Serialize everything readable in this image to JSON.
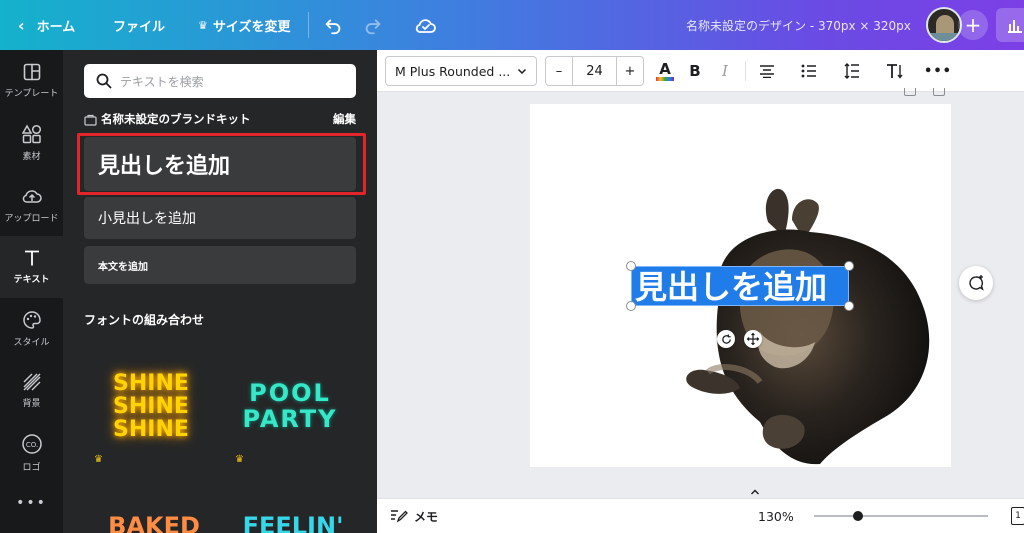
{
  "topbar": {
    "home": "ホーム",
    "file": "ファイル",
    "resize": "サイズを変更",
    "title": "名称未設定のデザイン - 370px × 320px"
  },
  "rail": {
    "items": [
      {
        "label": "テンプレート",
        "icon": "layout-icon"
      },
      {
        "label": "素材",
        "icon": "shapes-icon"
      },
      {
        "label": "アップロード",
        "icon": "upload-icon"
      },
      {
        "label": "テキスト",
        "icon": "text-icon"
      },
      {
        "label": "スタイル",
        "icon": "palette-icon"
      },
      {
        "label": "背景",
        "icon": "hatch-icon"
      },
      {
        "label": "ロゴ",
        "icon": "logo-icon"
      }
    ]
  },
  "panel": {
    "search_placeholder": "テキストを検索",
    "brand_kit": "名称未設定のブランドキット",
    "edit": "編集",
    "add_heading": "見出しを追加",
    "add_subheading": "小見出しを追加",
    "add_body": "本文を追加",
    "font_combos": "フォントの組み合わせ",
    "combos": [
      {
        "text": [
          "SHINE",
          "SHINE",
          "SHINE"
        ],
        "color": "#ffd400"
      },
      {
        "text": [
          "POOL",
          "PARTY"
        ],
        "color": "#37e8c8"
      },
      {
        "text": [
          "BAKED"
        ],
        "color": "#ff8c42"
      },
      {
        "text": [
          "FEELIN'"
        ],
        "color": "#36d7e8"
      }
    ]
  },
  "toolbar": {
    "font": "M Plus Rounded ...",
    "font_size": "24",
    "bold": "B",
    "italic": "I"
  },
  "canvas": {
    "text": "見出しを追加",
    "selection_color": "#1f7ce8"
  },
  "bottombar": {
    "notes": "メモ",
    "zoom": "130%",
    "zoom_level": 0.25
  },
  "colors": {
    "accent": "#7c3fe6",
    "highlight_box": "#e0262b"
  }
}
